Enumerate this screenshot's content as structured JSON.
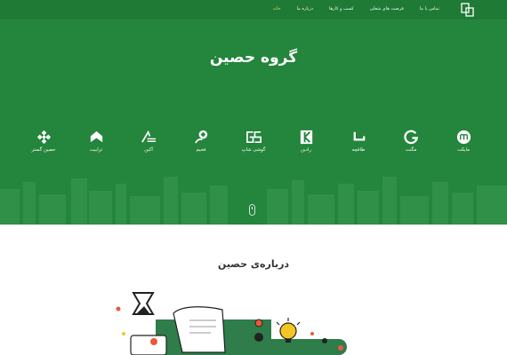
{
  "nav": {
    "items": [
      {
        "label": "خانه",
        "active": true
      },
      {
        "label": "درباره ما",
        "active": false
      },
      {
        "label": "کسب و کارها",
        "active": false
      },
      {
        "label": "فرصت های شغلی",
        "active": false
      },
      {
        "label": "تماس با ما",
        "active": false
      }
    ]
  },
  "hero": {
    "title": "گروه حصین"
  },
  "brands": [
    {
      "label": "مایکت",
      "icon": "myket-icon"
    },
    {
      "label": "مگنت",
      "icon": "magnet-icon"
    },
    {
      "label": "طاقچه",
      "icon": "taaghche-icon"
    },
    {
      "label": "رادین",
      "icon": "radin-icon"
    },
    {
      "label": "گوشی شاپ",
      "icon": "gooshishop-icon"
    },
    {
      "label": "فخیم",
      "icon": "fakhim-icon"
    },
    {
      "label": "آکین",
      "icon": "akin-icon"
    },
    {
      "label": "ترابیت",
      "icon": "torabit-icon"
    },
    {
      "label": "حصین گستر",
      "icon": "hasin-gostar-icon"
    }
  ],
  "about": {
    "title": "درباره‌ی حصین"
  },
  "colors": {
    "hero_green": "#24853c",
    "nav_green": "#1f7a36",
    "active_nav": "#f0cf47",
    "illustration_green": "#2e7d4a",
    "accent_orange": "#e85a3b",
    "accent_yellow": "#f3c623"
  }
}
